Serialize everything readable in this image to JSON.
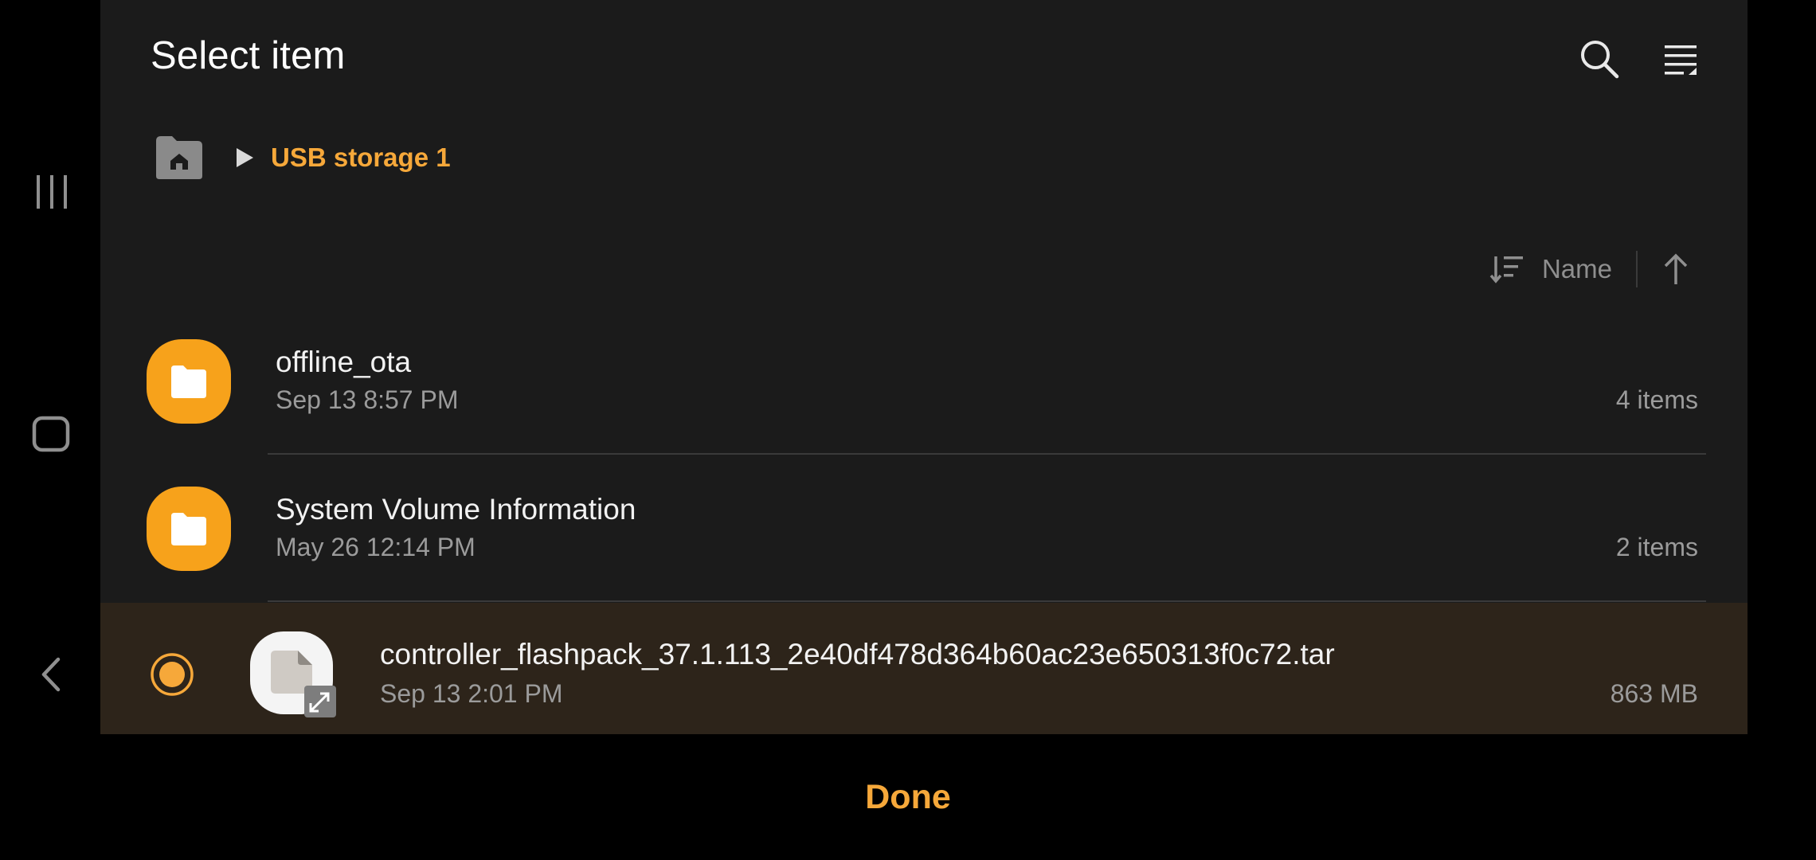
{
  "header": {
    "title": "Select item",
    "search_icon": "search-icon",
    "menu_icon": "list-menu-icon"
  },
  "breadcrumb": {
    "home_icon": "home-folder-icon",
    "separator_icon": "triangle-right-icon",
    "current": "USB storage 1"
  },
  "sort": {
    "label": "Name",
    "order_icon": "sort-icon",
    "direction_icon": "arrow-up-icon"
  },
  "files": [
    {
      "name": "offline_ota",
      "date": "Sep 13 8:57 PM",
      "meta": "4 items",
      "type": "folder"
    },
    {
      "name": "System Volume Information",
      "date": "May 26 12:14 PM",
      "meta": "2 items",
      "type": "folder"
    },
    {
      "name": "controller_flashpack_37.1.113_2e40df478d364b60ac23e650313f0c72.tar",
      "date": "Sep 13 2:01 PM",
      "meta": "863 MB",
      "type": "file",
      "selected": true
    }
  ],
  "footer": {
    "done_label": "Done"
  },
  "colors": {
    "accent": "#f6a83a",
    "panel": "#1b1b1b",
    "selected_row": "#2d241a",
    "folder": "#f7a21b"
  }
}
